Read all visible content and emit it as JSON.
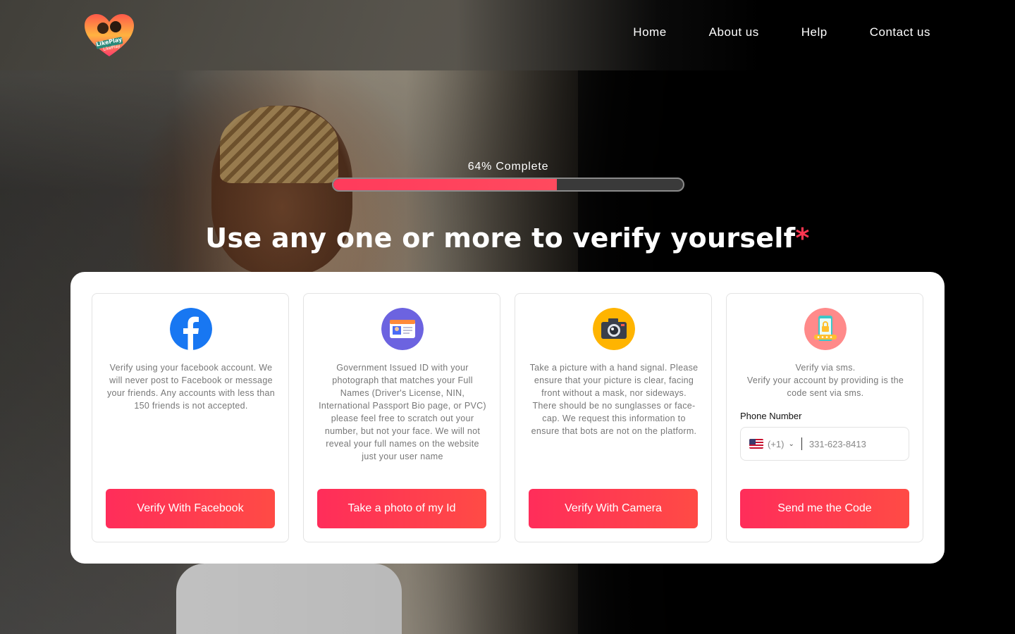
{
  "nav": {
    "items": [
      "Home",
      "About us",
      "Help",
      "Contact us"
    ]
  },
  "brand": {
    "logo_text_1": "LikePlay",
    "logo_text_2": "LikePlay"
  },
  "progress": {
    "label": "64% Complete",
    "value": 0.64
  },
  "heading": {
    "text": "Use any one or more to verify yourself",
    "required_mark": "*"
  },
  "cards": [
    {
      "icon": "facebook-icon",
      "description": "Verify using your facebook account. We will never post to Facebook or message your friends. Any accounts with less than 150 friends is not accepted.",
      "button_label": "Verify With Facebook"
    },
    {
      "icon": "id-card-icon",
      "description": "Government Issued ID with your photograph that matches your Full Names (Driver's License, NIN, International Passport Bio page, or PVC) please feel free to scratch out your number, but not your face. We will not reveal your full names on the website just your user name",
      "button_label": "Take a photo of my Id"
    },
    {
      "icon": "camera-icon",
      "description": "Take a picture with a hand signal. Please ensure that your picture is clear, facing front without a mask, nor sideways. There should be no sunglasses or face-cap. We request this information to ensure that bots are not on the platform.",
      "button_label": "Verify With Camera"
    },
    {
      "icon": "phone-lock-icon",
      "description_line1": "Verify via sms.",
      "description_line2": "Verify your account by providing is the code sent via sms.",
      "phone_label": "Phone Number",
      "country_code": "(+1)",
      "phone_placeholder": "331-623-8413",
      "button_label": "Send me the Code"
    }
  ],
  "colors": {
    "accent": "#ff2d5a",
    "accent_end": "#ff4b45",
    "required": "#ff3550"
  }
}
